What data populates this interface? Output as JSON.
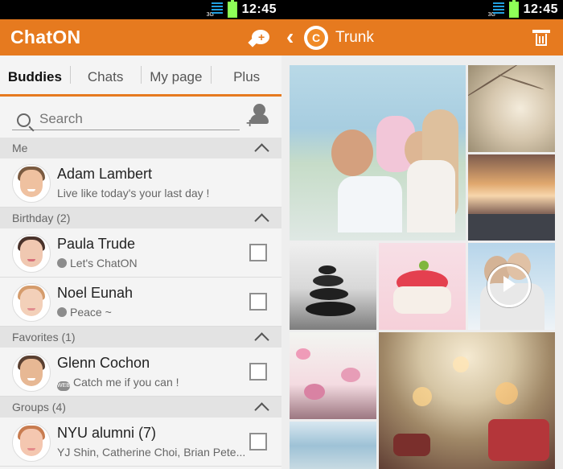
{
  "status": {
    "left_time": "12:45",
    "right_time": "12:45",
    "network": "3G",
    "accent": "#e67a1f"
  },
  "left_header": {
    "title": "ChatON"
  },
  "right_header": {
    "title": "Trunk",
    "logo_letter": "C"
  },
  "tabs": [
    {
      "label": "Buddies"
    },
    {
      "label": "Chats"
    },
    {
      "label": "My page"
    },
    {
      "label": "Plus"
    }
  ],
  "search": {
    "placeholder": "Search"
  },
  "sections": {
    "me": "Me",
    "birthday": "Birthday (2)",
    "favorites": "Favorites (1)",
    "groups": "Groups (4)"
  },
  "contacts": {
    "me": {
      "name": "Adam Lambert",
      "status": "Live like today's your last day !"
    },
    "birthday": [
      {
        "name": "Paula Trude",
        "status": "Let's ChatON"
      },
      {
        "name": "Noel Eunah",
        "status": "Peace ~"
      }
    ],
    "favorites": [
      {
        "name": "Glenn Cochon",
        "status": "Catch me if you can !"
      }
    ],
    "groups": [
      {
        "name": "NYU alumni (7)",
        "status": "YJ Shin, Catherine Choi, Brian Pete..."
      }
    ]
  },
  "badges": {
    "web": "WEB"
  },
  "icons": {
    "compose": "chat-compose-icon",
    "back": "back-arrow-icon",
    "trash": "trash-icon",
    "search": "search-icon",
    "add_buddy": "add-buddy-icon",
    "play": "play-icon"
  }
}
